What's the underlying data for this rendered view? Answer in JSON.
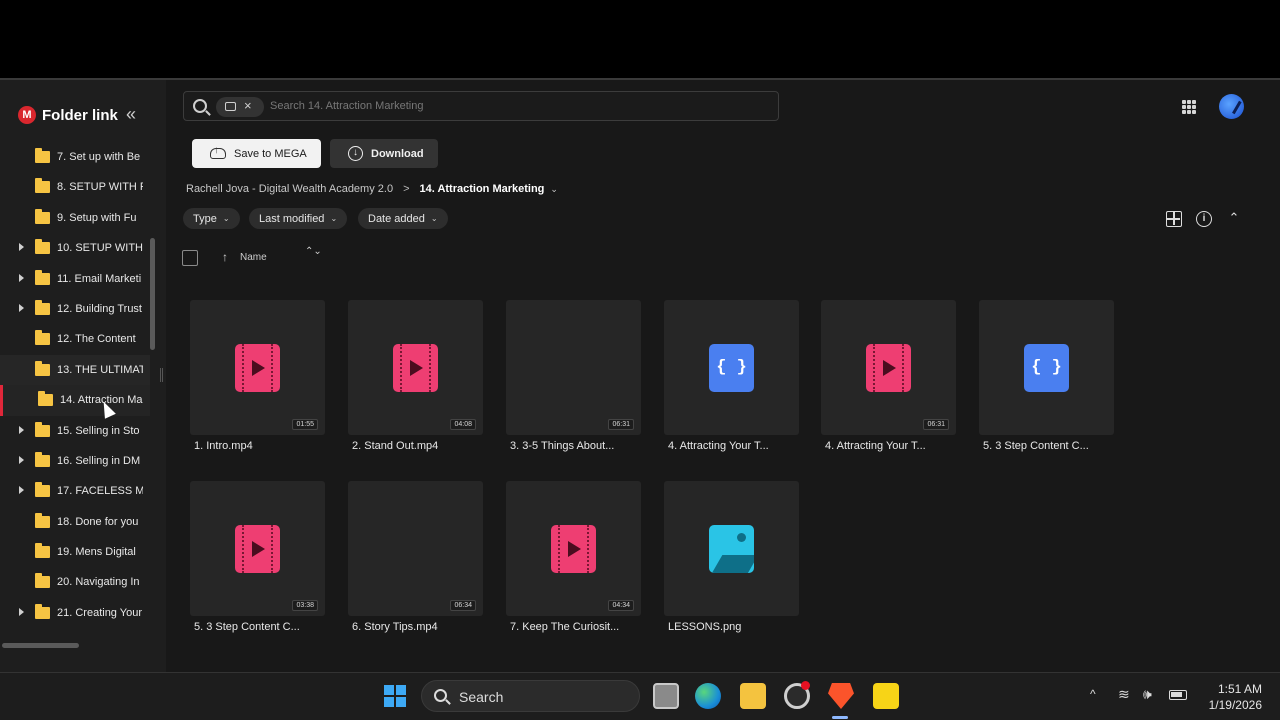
{
  "sidebar": {
    "title": "Folder link",
    "logo_letter": "M",
    "collapse_glyph": "«",
    "items": [
      {
        "label": "7. Set up with Be",
        "expandable": false
      },
      {
        "label": "8. SETUP WITH F",
        "expandable": false
      },
      {
        "label": "9. Setup with Fu",
        "expandable": false
      },
      {
        "label": "10. SETUP WITH",
        "expandable": true
      },
      {
        "label": "11. Email Marketi",
        "expandable": true
      },
      {
        "label": "12. Building Trust",
        "expandable": true
      },
      {
        "label": "12. The Content",
        "expandable": false
      },
      {
        "label": "13. THE ULTIMAT",
        "expandable": false
      },
      {
        "label": "14. Attraction Ma",
        "expandable": false
      },
      {
        "label": "15. Selling in Sto",
        "expandable": true
      },
      {
        "label": "16. Selling in DM",
        "expandable": true
      },
      {
        "label": "17. FACELESS MA",
        "expandable": true
      },
      {
        "label": "18. Done for you",
        "expandable": false
      },
      {
        "label": "19. Mens Digital",
        "expandable": false
      },
      {
        "label": "20. Navigating In",
        "expandable": false
      },
      {
        "label": "21. Creating Your",
        "expandable": true
      }
    ],
    "active_index": 8,
    "hover_index": 7
  },
  "search": {
    "placeholder": "Search 14. Attraction Marketing",
    "chip_close": "×"
  },
  "toolbar": {
    "save_label": "Save to MEGA",
    "download_label": "Download",
    "download_glyph": "↓"
  },
  "breadcrumb": {
    "root": "Rachell Jova - Digital Wealth Academy 2.0",
    "sep": ">",
    "current": "14. Attraction Marketing",
    "chevron": "⌄"
  },
  "filters": {
    "type": "Type",
    "last_modified": "Last modified",
    "date_added": "Date added",
    "chevron": "⌄"
  },
  "list_header": {
    "name": "Name",
    "sort_glyph": "↑",
    "toggle_glyph": "⌃⌄"
  },
  "view_controls": {
    "info_glyph": "i",
    "collapse_glyph": "⌃"
  },
  "files": [
    {
      "name": "1. Intro.mp4",
      "kind": "video",
      "duration": "01:55"
    },
    {
      "name": "2. Stand Out.mp4",
      "kind": "video",
      "duration": "04:08"
    },
    {
      "name": "3. 3-5 Things About...",
      "kind": "blank",
      "duration": "06:31"
    },
    {
      "name": "4. Attracting Your T...",
      "kind": "code",
      "duration": ""
    },
    {
      "name": "4. Attracting Your T...",
      "kind": "video",
      "duration": "06:31"
    },
    {
      "name": "5. 3 Step Content C...",
      "kind": "code",
      "duration": ""
    },
    {
      "name": "5. 3 Step Content C...",
      "kind": "video",
      "duration": "03:38"
    },
    {
      "name": "6. Story Tips.mp4",
      "kind": "blank",
      "duration": "06:34"
    },
    {
      "name": "7. Keep The Curiosit...",
      "kind": "video",
      "duration": "04:34"
    },
    {
      "name": "LESSONS.png",
      "kind": "image",
      "duration": ""
    }
  ],
  "code_glyph": "{ }",
  "taskbar": {
    "search_label": "Search",
    "time": "1:51 AM",
    "date": "1/19/2026",
    "tray_chevron": "^",
    "wifi_glyph": "≋",
    "volume_glyph": "🕪"
  }
}
